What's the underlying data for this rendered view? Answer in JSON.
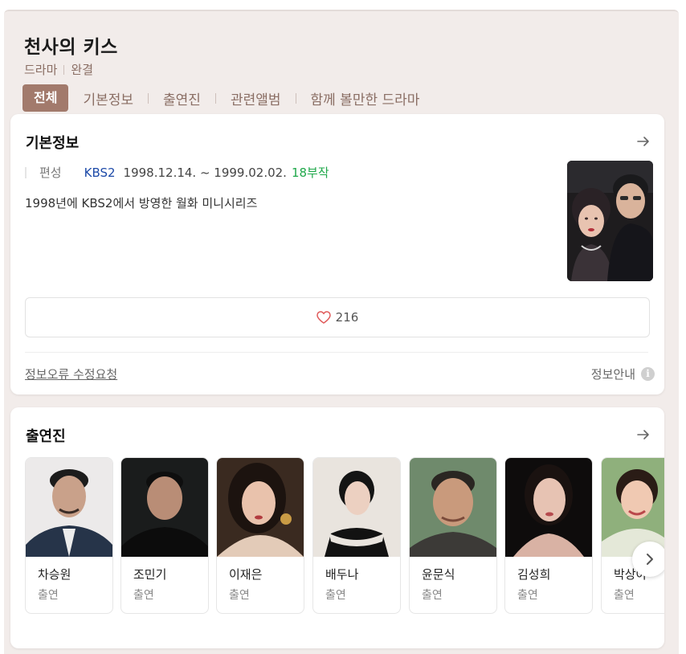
{
  "header": {
    "title": "천사의 키스",
    "genre": "드라마",
    "status": "완결"
  },
  "tabs": [
    "전체",
    "기본정보",
    "출연진",
    "관련앨범",
    "함께 볼만한 드라마"
  ],
  "basic_info": {
    "section_title": "기본정보",
    "label": "편성",
    "network": "KBS2",
    "dates": "1998.12.14. ~ 1999.02.02.",
    "episodes": "18부작",
    "description": "1998년에 KBS2에서 방영한 월화 미니시리즈",
    "likes": "216",
    "report_link": "정보오류 수정요청",
    "info_guide": "정보안내",
    "info_icon": "i"
  },
  "cast": {
    "section_title": "출연진",
    "members": [
      {
        "name": "차승원",
        "role": "출연"
      },
      {
        "name": "조민기",
        "role": "출연"
      },
      {
        "name": "이재은",
        "role": "출연"
      },
      {
        "name": "배두나",
        "role": "출연"
      },
      {
        "name": "윤문식",
        "role": "출연"
      },
      {
        "name": "김성희",
        "role": "출연"
      },
      {
        "name": "박상아",
        "role": "출연"
      }
    ]
  },
  "colors": {
    "accent": "#a27a6c",
    "background": "#f2ecea",
    "network": "#1d4aa8",
    "episodes": "#1fa84a"
  }
}
